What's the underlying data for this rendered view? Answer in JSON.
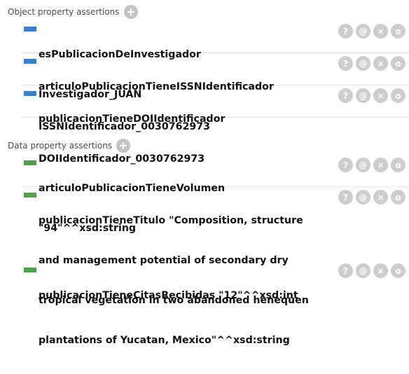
{
  "object_properties": {
    "header": "Object property assertions",
    "items": [
      {
        "property": "esPublicacionDeInvestigador",
        "value": "Investigador_JUAN"
      },
      {
        "property": "articuloPublicacionTieneISSNIdentificador",
        "value": "ISSNIdentificador_0030762973"
      },
      {
        "property": "publicacionTieneDOIIdentificador",
        "value": "DOIIdentificador_0030762973"
      }
    ]
  },
  "data_properties": {
    "header": "Data property assertions",
    "items": [
      {
        "lines": [
          "articuloPublicacionTieneVolumen",
          "\"94\"^^xsd:string"
        ]
      },
      {
        "lines": [
          "publicacionTieneTitulo  \"Composition, structure",
          "and management potential of secondary dry",
          "tropical vegetation in two abandoned henequen",
          "plantations of Yucatan, Mexico\"^^xsd:string"
        ]
      },
      {
        "lines": [
          "publicacionTieneCitasRecibidas  \"12\"^^xsd:int"
        ]
      }
    ]
  },
  "actions": {
    "explain": "?",
    "annotate": "@",
    "delete": "×",
    "edit": "o"
  },
  "colors": {
    "object_swatch": "#3a7ed0",
    "data_swatch": "#4fa24a",
    "action_button": "#cdcdcd"
  }
}
